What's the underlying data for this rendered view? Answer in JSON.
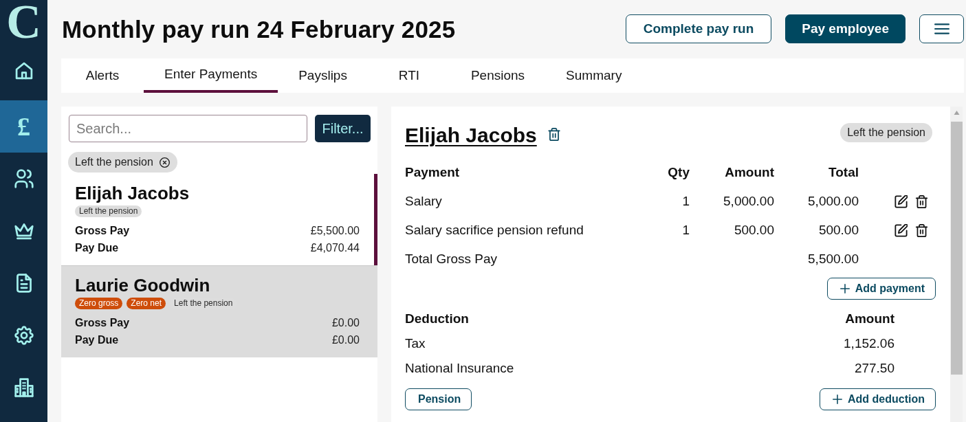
{
  "sidebar": {
    "logo": "C",
    "items": [
      {
        "kind": "home",
        "selected": false
      },
      {
        "kind": "glyph",
        "glyph": "£",
        "selected": true
      },
      {
        "kind": "people",
        "selected": false
      },
      {
        "kind": "crown",
        "selected": false
      },
      {
        "kind": "document",
        "selected": false
      },
      {
        "kind": "settings",
        "selected": false
      },
      {
        "kind": "building",
        "selected": false
      }
    ]
  },
  "header": {
    "title": "Monthly pay run 24 February 2025",
    "buttons": [
      {
        "kind": "outline",
        "label": "Complete pay run"
      },
      {
        "kind": "primary",
        "label": "Pay employee"
      },
      {
        "kind": "menu"
      }
    ]
  },
  "tabs": [
    {
      "label": "Alerts",
      "selected": false
    },
    {
      "label": "Enter Payments",
      "selected": true
    },
    {
      "label": "Payslips",
      "selected": false
    },
    {
      "label": "RTI",
      "selected": false
    },
    {
      "label": "Pensions",
      "selected": false
    },
    {
      "label": "Summary",
      "selected": false
    }
  ],
  "employee_list": {
    "search": {
      "placeholder": "Search..."
    },
    "filter_button": "Filter...",
    "active_filters": [
      {
        "label": "Left the pension"
      }
    ],
    "employees": [
      {
        "name": "Elijah Jacobs",
        "selected": true,
        "highlighted": false,
        "tags": [
          {
            "label": "Left the pension",
            "kind": "neutral"
          }
        ],
        "gross_pay_label": "Gross Pay",
        "gross_pay": "£5,500.00",
        "pay_due_label": "Pay Due",
        "pay_due": "£4,070.44"
      },
      {
        "name": "Laurie Goodwin",
        "selected": false,
        "highlighted": true,
        "tags": [
          {
            "label": "Zero gross",
            "kind": "warning"
          },
          {
            "label": "Zero net",
            "kind": "warning"
          },
          {
            "label": "Left the pension",
            "kind": "neutral"
          }
        ],
        "gross_pay_label": "Gross Pay",
        "gross_pay": "£0.00",
        "pay_due_label": "Pay Due",
        "pay_due": "£0.00"
      }
    ]
  },
  "payslip": {
    "employee_name": "Elijah Jacobs",
    "badge": "Left the pension",
    "payments": {
      "columns": [
        "Payment",
        "Qty",
        "Amount",
        "Total"
      ],
      "rows": [
        {
          "name": "Salary",
          "qty": "1",
          "amount": "5,000.00",
          "total": "5,000.00",
          "editable": true
        },
        {
          "name": "Salary sacrifice pension refund",
          "qty": "1",
          "amount": "500.00",
          "total": "500.00",
          "editable": true
        },
        {
          "name": "Total Gross Pay",
          "total": "5,500.00",
          "editable": false
        }
      ]
    },
    "add_payment_button": "Add payment",
    "deductions": {
      "columns": [
        "Deduction",
        "Amount"
      ],
      "rows": [
        {
          "name": "Tax",
          "amount": "1,152.06"
        },
        {
          "name": "National Insurance",
          "amount": "277.50"
        }
      ]
    },
    "pension_button": "Pension",
    "add_deduction_button": "Add deduction"
  }
}
